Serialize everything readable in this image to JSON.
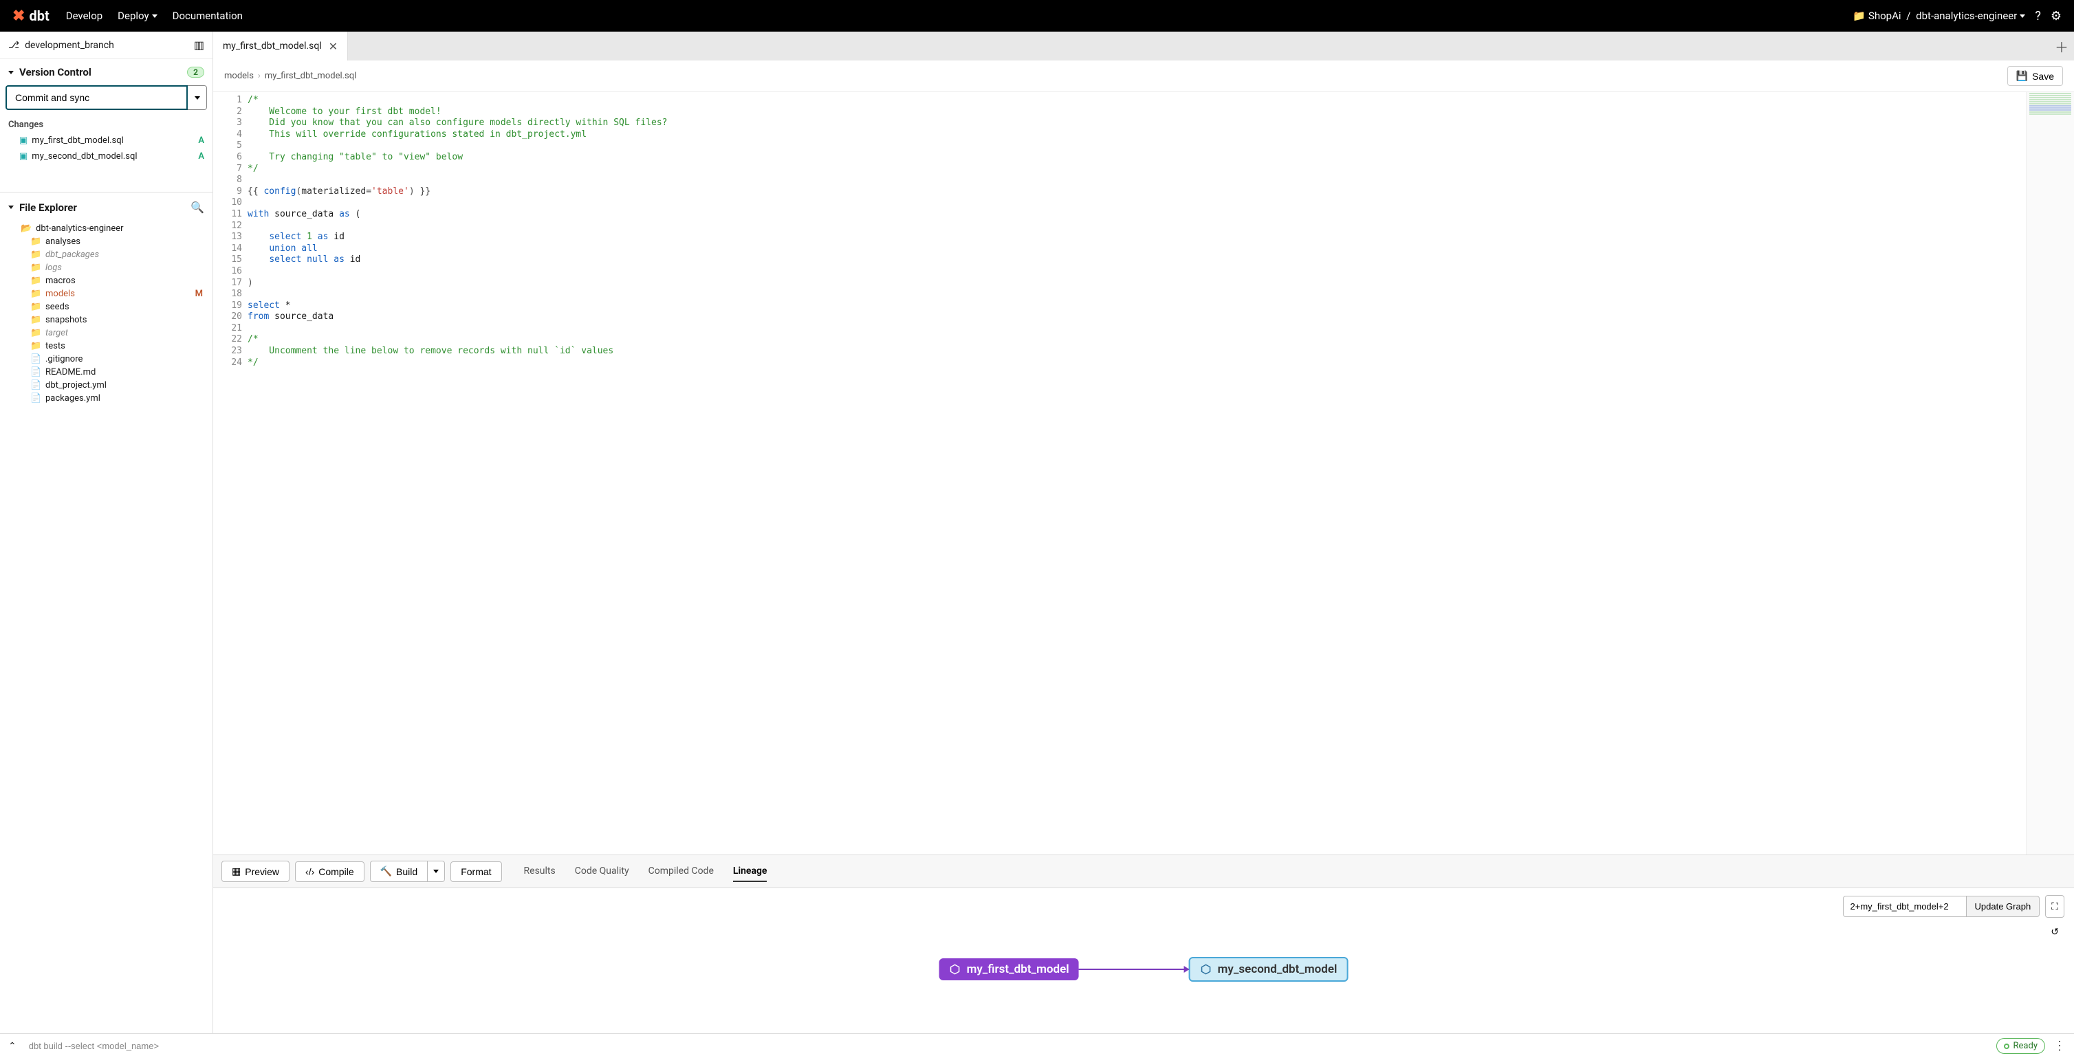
{
  "topnav": {
    "brand": "dbt",
    "links": {
      "develop": "Develop",
      "deploy": "Deploy",
      "documentation": "Documentation"
    },
    "org": "ShopAi",
    "project": "dbt-analytics-engineer"
  },
  "sidebar": {
    "branch": "development_branch",
    "vc_header": "Version Control",
    "vc_count": "2",
    "commit_label": "Commit and sync",
    "changes_label": "Changes",
    "changes": [
      {
        "name": "my_first_dbt_model.sql",
        "status": "A"
      },
      {
        "name": "my_second_dbt_model.sql",
        "status": "A"
      }
    ],
    "fe_header": "File Explorer",
    "root": "dbt-analytics-engineer",
    "tree": [
      {
        "name": "analyses",
        "type": "folder",
        "muted": false
      },
      {
        "name": "dbt_packages",
        "type": "folder",
        "muted": true
      },
      {
        "name": "logs",
        "type": "folder",
        "muted": true
      },
      {
        "name": "macros",
        "type": "folder",
        "muted": false
      },
      {
        "name": "models",
        "type": "folder",
        "muted": false,
        "modified": true,
        "mark": "M"
      },
      {
        "name": "seeds",
        "type": "folder",
        "muted": false
      },
      {
        "name": "snapshots",
        "type": "folder",
        "muted": false
      },
      {
        "name": "target",
        "type": "folder",
        "muted": true
      },
      {
        "name": "tests",
        "type": "folder",
        "muted": false
      },
      {
        "name": ".gitignore",
        "type": "file",
        "muted": false
      },
      {
        "name": "README.md",
        "type": "file",
        "muted": false
      },
      {
        "name": "dbt_project.yml",
        "type": "file",
        "muted": false
      },
      {
        "name": "packages.yml",
        "type": "file",
        "muted": false
      }
    ]
  },
  "tabs": {
    "active": "my_first_dbt_model.sql"
  },
  "breadcrumb": {
    "a": "models",
    "b": "my_first_dbt_model.sql",
    "save": "Save"
  },
  "editor": {
    "lines": [
      [
        [
          "comment",
          "/*"
        ]
      ],
      [
        [
          "comment",
          "    Welcome to your first dbt model!"
        ]
      ],
      [
        [
          "comment",
          "    Did you know that you can also configure models directly within SQL files?"
        ]
      ],
      [
        [
          "comment",
          "    This will override configurations stated in dbt_project.yml"
        ]
      ],
      [
        [
          "",
          ""
        ]
      ],
      [
        [
          "comment",
          "    Try changing \"table\" to \"view\" below"
        ]
      ],
      [
        [
          "comment",
          "*/"
        ]
      ],
      [
        [
          "",
          ""
        ]
      ],
      [
        [
          "templ",
          "{{ "
        ],
        [
          "fn",
          "config"
        ],
        [
          "punc",
          "("
        ],
        [
          "ident",
          "materialized"
        ],
        [
          "op",
          "="
        ],
        [
          "str",
          "'table'"
        ],
        [
          "punc",
          ")"
        ],
        [
          "templ",
          " }}"
        ]
      ],
      [
        [
          "",
          ""
        ]
      ],
      [
        [
          "kw",
          "with"
        ],
        [
          "",
          " source_data "
        ],
        [
          "kw",
          "as"
        ],
        [
          "",
          " ("
        ]
      ],
      [
        [
          "",
          ""
        ]
      ],
      [
        [
          "",
          "    "
        ],
        [
          "kw",
          "select"
        ],
        [
          "",
          " "
        ],
        [
          "num",
          "1"
        ],
        [
          "",
          " "
        ],
        [
          "kw",
          "as"
        ],
        [
          "",
          " id"
        ]
      ],
      [
        [
          "",
          "    "
        ],
        [
          "kw",
          "union all"
        ]
      ],
      [
        [
          "",
          "    "
        ],
        [
          "kw",
          "select"
        ],
        [
          "",
          " "
        ],
        [
          "kw",
          "null"
        ],
        [
          "",
          " "
        ],
        [
          "kw",
          "as"
        ],
        [
          "",
          " id"
        ]
      ],
      [
        [
          "",
          ""
        ]
      ],
      [
        [
          "punc",
          ")"
        ]
      ],
      [
        [
          "",
          ""
        ]
      ],
      [
        [
          "kw",
          "select"
        ],
        [
          "",
          " *"
        ]
      ],
      [
        [
          "kw",
          "from"
        ],
        [
          "",
          " source_data"
        ]
      ],
      [
        [
          "",
          ""
        ]
      ],
      [
        [
          "comment",
          "/*"
        ]
      ],
      [
        [
          "comment",
          "    Uncomment the line below to remove records with null `id` values"
        ]
      ],
      [
        [
          "comment",
          "*/"
        ]
      ]
    ]
  },
  "bottom": {
    "buttons": {
      "preview": "Preview",
      "compile": "Compile",
      "build": "Build",
      "format": "Format"
    },
    "tabs": {
      "results": "Results",
      "code_quality": "Code Quality",
      "compiled": "Compiled Code",
      "lineage": "Lineage"
    },
    "lineage": {
      "input_value": "2+my_first_dbt_model+2",
      "update": "Update Graph",
      "node1": "my_first_dbt_model",
      "node2": "my_second_dbt_model"
    }
  },
  "statusbar": {
    "command": "dbt build --select <model_name>",
    "ready": "Ready"
  }
}
